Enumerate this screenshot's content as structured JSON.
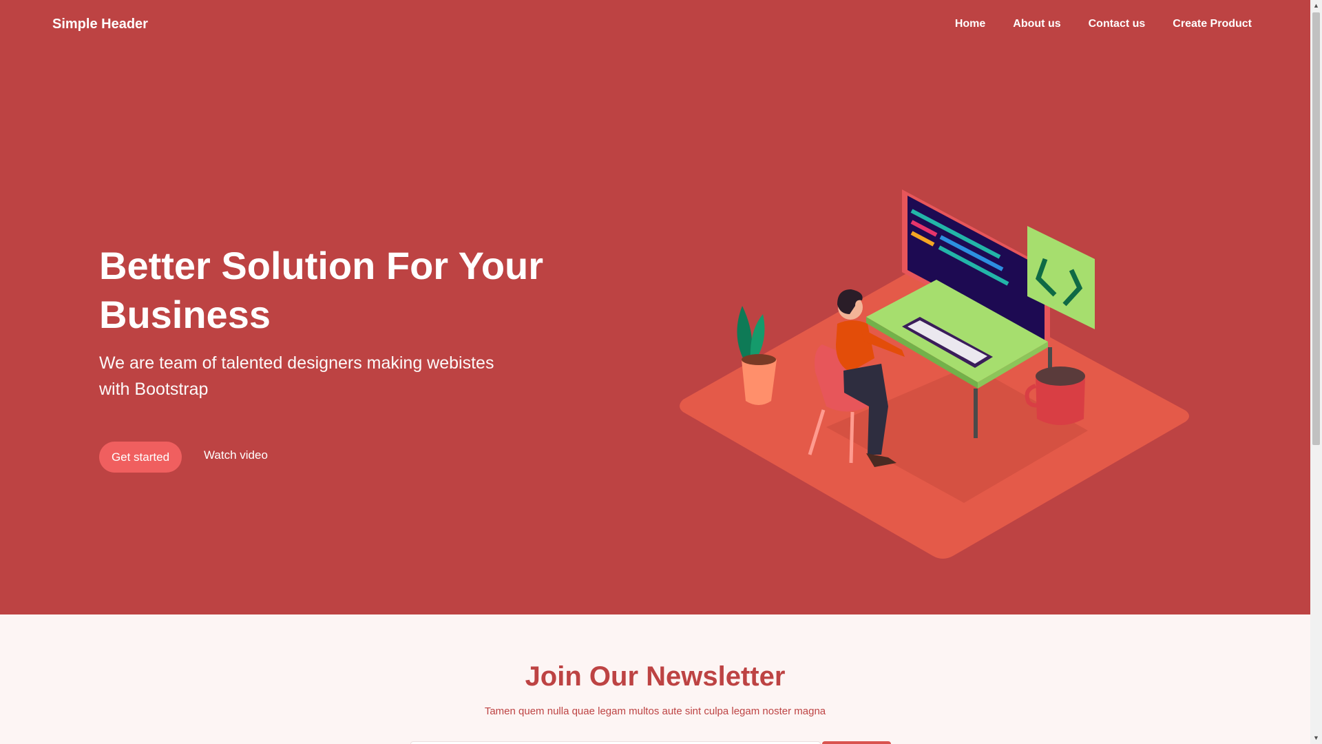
{
  "header": {
    "brand": "Simple Header",
    "nav": [
      "Home",
      "About us",
      "Contact us",
      "Create Product"
    ]
  },
  "hero": {
    "title": "Better Solution For Your Business",
    "subtitle": "We are team of talented designers making webistes with Bootstrap",
    "primary_button": "Get started",
    "secondary_button": "Watch video",
    "illustration": "developer-at-desk-illustration",
    "code_badge": "< >"
  },
  "newsletter": {
    "title": "Join Our Newsletter",
    "text": "Tamen quem nulla quae legam multos aute sint culpa legam noster magna",
    "email_value": "",
    "email_placeholder": "",
    "subscribe_label": ""
  },
  "colors": {
    "hero_background": "#bd4343",
    "accent": "#f05f5f",
    "newsletter_background": "#fdf5f4",
    "desk_platform": "#e45a49",
    "desk_top": "#a6de6e",
    "monitor_screen": "#1d0a52"
  },
  "scrollbar": {
    "up_icon": "scroll-up-arrow-icon",
    "down_icon": "scroll-down-arrow-icon"
  }
}
